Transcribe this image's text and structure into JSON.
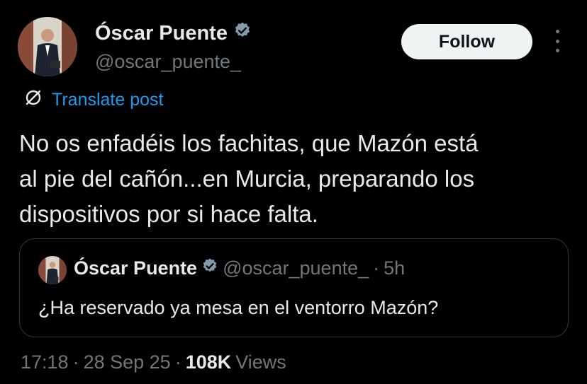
{
  "author": {
    "display_name": "Óscar Puente",
    "handle": "@oscar_puente_",
    "verified_icon": "verified-badge-icon"
  },
  "actions": {
    "follow_label": "Follow",
    "more_icon": "more-vertical-icon"
  },
  "translate": {
    "label": "Translate post",
    "icon": "translate-icon"
  },
  "post": {
    "lines": [
      "No os enfadéis los fachitas, que Mazón está",
      "al pie del cañón...en Murcia, preparando los",
      "dispositivos por si hace falta."
    ]
  },
  "quoted_post": {
    "display_name": "Óscar Puente",
    "handle": "@oscar_puente_",
    "separator": "·",
    "age": "5h",
    "text": "¿Ha reservado ya mesa en el ventorro Mazón?"
  },
  "footer": {
    "time": "17:18",
    "sep1": "·",
    "date": "28 Sep 25",
    "sep2": "·",
    "views_count": "108K",
    "views_label": "Views"
  },
  "colors": {
    "background": "#000000",
    "text": "#e7e9ea",
    "muted": "#71767b",
    "link": "#1d9bf0",
    "verified": "#829aab",
    "follow_bg": "#eff3f4"
  }
}
